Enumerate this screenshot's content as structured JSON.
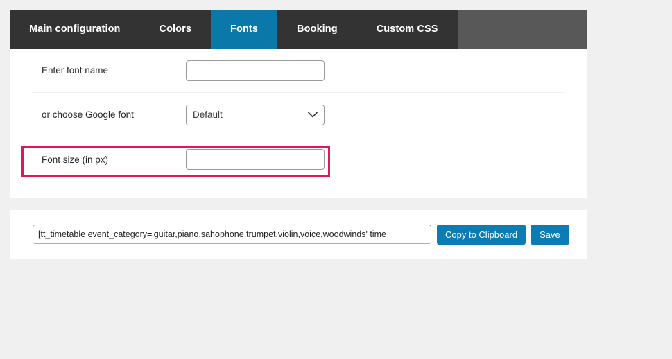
{
  "theme": {
    "page_background": "#f0f0f0",
    "tabbar_background": "#585858",
    "tab_background": "#333333",
    "accent_blue": "#0a78a8",
    "button_blue": "#0c7cb4",
    "highlight_border": "#e0175b",
    "panel_background": "#ffffff"
  },
  "tabs": [
    {
      "label": "Main configuration",
      "active": false
    },
    {
      "label": "Colors",
      "active": false
    },
    {
      "label": "Fonts",
      "active": true
    },
    {
      "label": "Booking",
      "active": false
    },
    {
      "label": "Custom CSS",
      "active": false
    }
  ],
  "form": {
    "rows": [
      {
        "label": "Enter font name",
        "control": "text",
        "value": "",
        "placeholder": ""
      },
      {
        "label": "or choose Google font",
        "control": "select",
        "value": "Default",
        "options": [
          "Default"
        ],
        "chevron_icon": "chevron-down-icon"
      },
      {
        "label": "Font size (in px)",
        "control": "text",
        "value": "",
        "placeholder": "",
        "highlighted": true
      }
    ]
  },
  "shortcode": {
    "value": "[tt_timetable event_category='guitar,piano,sahophone,trumpet,violin,voice,woodwinds' time",
    "placeholder": "",
    "copy_label": "Copy to Clipboard",
    "save_label": "Save"
  }
}
